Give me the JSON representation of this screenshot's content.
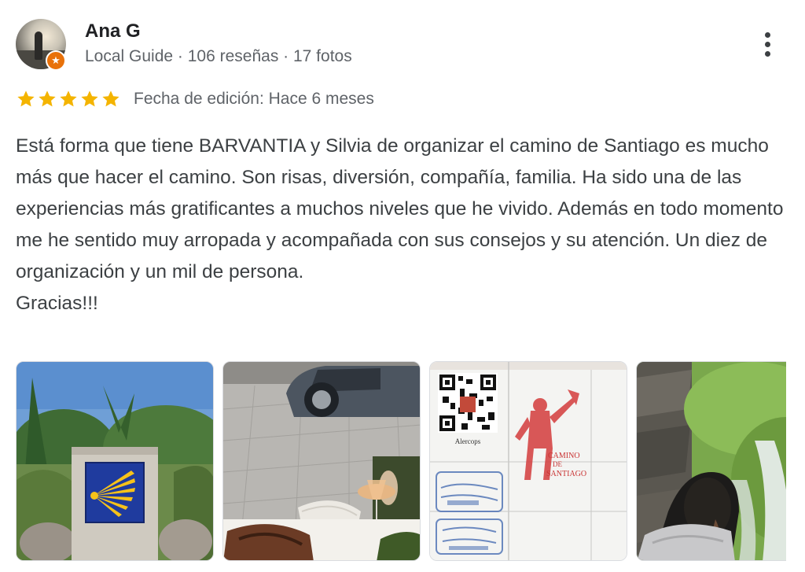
{
  "reviewer": {
    "name": "Ana G",
    "meta": "Local Guide · 106 reseñas · 17 fotos",
    "badge_icon": "local-guide-star-icon"
  },
  "menu": {
    "icon": "more-vert-icon"
  },
  "rating": {
    "stars": 5,
    "max_stars": 5,
    "star_color": "#f4b400",
    "date_text": "Fecha de edición: Hace 6 meses"
  },
  "review": {
    "text": "Está forma que tiene BARVANTIA y Silvia de organizar el camino de Santiago es mucho más que hacer el camino. Son risas, diversión, compañía, familia. Ha sido una de las experiencias más gratificantes a muchos niveles que he vivido. Además en todo momento me he sentido muy arropada y acompañada con sus consejos y su atención. Un diez de organización y un mil de persona.\nGracias!!!"
  },
  "photos": {
    "count_visible": 4,
    "stamp_texts": {
      "qr_caption": "Alercops",
      "camino_line1": "CAMINO",
      "camino_line2": "DE",
      "camino_line3": "SANTIAGO"
    }
  }
}
